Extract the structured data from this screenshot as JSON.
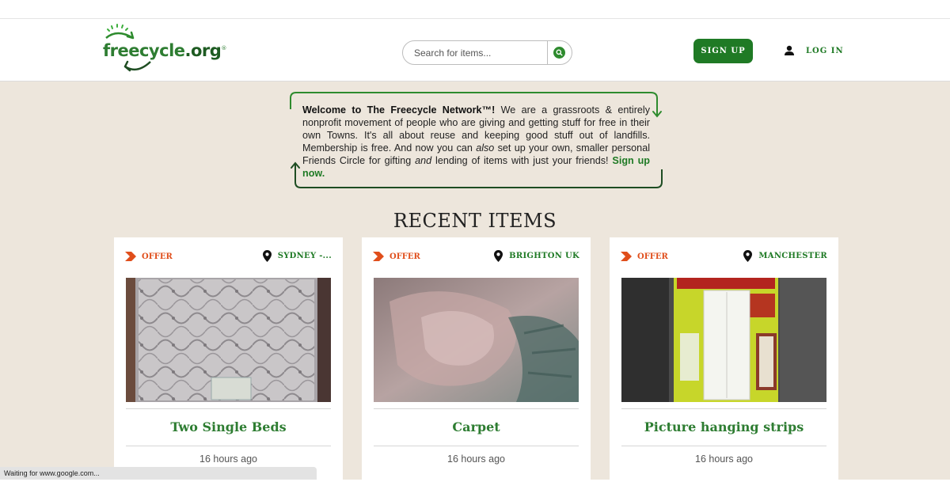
{
  "header": {
    "logo": {
      "text_main": "freecycle",
      "text_suffix": ".org",
      "mark": "®"
    },
    "search": {
      "placeholder": "Search for items..."
    },
    "signup_label": "SIGN UP",
    "login_label": "LOG IN"
  },
  "welcome": {
    "bold_intro": "Welcome to The Freecycle Network™!",
    "part1": " We are a grassroots & entirely nonprofit movement of people who are giving and getting stuff for free in their own Towns. It's all about reuse and keeping good stuff out of landfills. Membership is free. And now you can ",
    "em1": "also",
    "part2": " set up your own, smaller personal Friends Circle for gifting ",
    "em2": "and",
    "part3": " lending of items with just your friends! ",
    "signup_link": "Sign up now."
  },
  "recent_heading": "RECENT ITEMS",
  "items": [
    {
      "type": "OFFER",
      "location": "SYDNEY -...",
      "title": "Two Single Beds",
      "time": "16 hours ago",
      "image": "mattress-photo"
    },
    {
      "type": "OFFER",
      "location": "BRIGHTON UK",
      "title": "Carpet",
      "time": "16 hours ago",
      "image": "carpet-photo"
    },
    {
      "type": "OFFER",
      "location": "MANCHESTER",
      "title": "Picture hanging strips",
      "time": "16 hours ago",
      "image": "hanging-strips-photo"
    }
  ],
  "status_bar": "Waiting for www.google.com...",
  "colors": {
    "brand_green": "#1f7a25",
    "offer_orange": "#e04e1b",
    "background": "#ede6dc"
  }
}
